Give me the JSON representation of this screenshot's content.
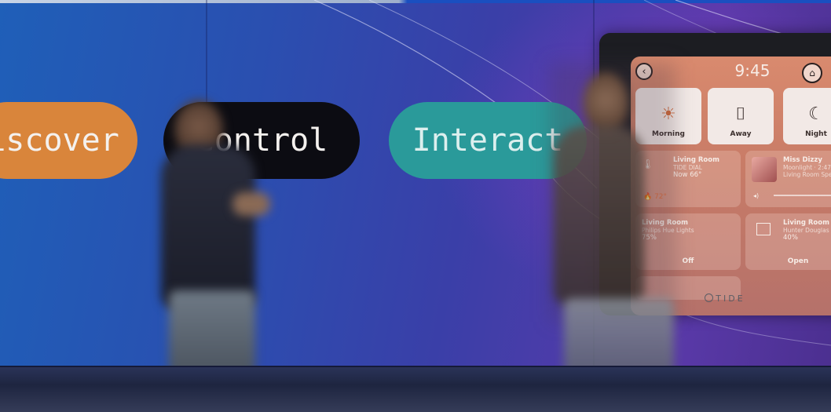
{
  "pills": {
    "discover": "iscover",
    "control": "Control",
    "interact": "Interact"
  },
  "device": {
    "brand": "TIDE",
    "time": "9:45",
    "scenes": [
      {
        "label": "Morning",
        "icon": "sunrise-icon"
      },
      {
        "label": "Away",
        "icon": "door-person-icon"
      },
      {
        "label": "Night",
        "icon": "moon-stars-icon"
      }
    ],
    "cards": {
      "thermostat": {
        "title": "Living Room",
        "subtitle": "TIDE DIAL",
        "value": "Now 66°",
        "setpoint": "72°"
      },
      "music": {
        "title": "Miss Dizzy",
        "subtitle": "Moonlight · 2:47",
        "room": "Living Room Spea"
      },
      "lights": {
        "title": "Living Room",
        "subtitle": "Philips Hue Lights",
        "value": "75%",
        "action": "Off"
      },
      "blinds": {
        "title": "Living Room",
        "subtitle": "Hunter Douglas Bl",
        "value": "40%",
        "action": "Open"
      }
    }
  },
  "colors": {
    "pill_discover": "#d9853b",
    "pill_control": "#0c0c12",
    "pill_interact": "#2a9a9a",
    "screen": "#d98a6e"
  }
}
